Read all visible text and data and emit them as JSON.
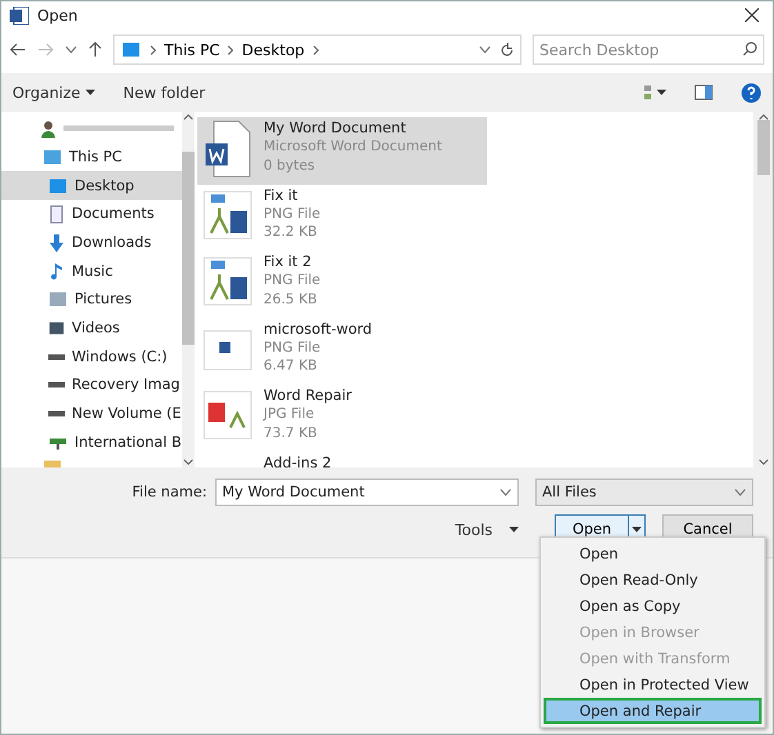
{
  "window": {
    "title": "Open"
  },
  "breadcrumb": [
    "This PC",
    "Desktop"
  ],
  "search": {
    "placeholder": "Search Desktop"
  },
  "toolbar": {
    "organize": "Organize",
    "new_folder": "New folder"
  },
  "sidebar": {
    "items": [
      {
        "label": "This PC",
        "kind": "pc",
        "selected": false,
        "children": [
          {
            "label": "Desktop",
            "kind": "desktop",
            "selected": true
          },
          {
            "label": "Documents",
            "kind": "doc",
            "selected": false
          },
          {
            "label": "Downloads",
            "kind": "download",
            "selected": false
          },
          {
            "label": "Music",
            "kind": "music",
            "selected": false
          },
          {
            "label": "Pictures",
            "kind": "pictures",
            "selected": false
          },
          {
            "label": "Videos",
            "kind": "videos",
            "selected": false
          },
          {
            "label": "Windows (C:)",
            "kind": "drive",
            "selected": false
          },
          {
            "label": "Recovery Imag",
            "kind": "drive",
            "selected": false
          },
          {
            "label": "New Volume (E",
            "kind": "drive",
            "selected": false
          },
          {
            "label": "International B",
            "kind": "network",
            "selected": false
          }
        ]
      }
    ]
  },
  "files": [
    {
      "name": "My Word Document",
      "type": "Microsoft Word Document",
      "size": "0 bytes",
      "kind": "word",
      "selected": true
    },
    {
      "name": "Fix it",
      "type": "PNG File",
      "size": "32.2 KB",
      "kind": "fixit",
      "selected": false
    },
    {
      "name": "Fix it 2",
      "type": "PNG File",
      "size": "26.5 KB",
      "kind": "fixit",
      "selected": false
    },
    {
      "name": "microsoft-word",
      "type": "PNG File",
      "size": "6.47 KB",
      "kind": "small",
      "selected": false
    },
    {
      "name": "Word Repair",
      "type": "JPG File",
      "size": "73.7 KB",
      "kind": "repair",
      "selected": false
    },
    {
      "name": "Add-ins 2",
      "kind": "partial",
      "selected": false
    }
  ],
  "file_name": {
    "label": "File name:",
    "value": "My Word Document"
  },
  "file_type": "All Files",
  "tools": "Tools",
  "open_button": "Open",
  "cancel_button": "Cancel",
  "open_menu": [
    {
      "label": "Open",
      "disabled": false,
      "selected": false
    },
    {
      "label": "Open Read-Only",
      "disabled": false,
      "selected": false
    },
    {
      "label": "Open as Copy",
      "disabled": false,
      "selected": false
    },
    {
      "label": "Open in Browser",
      "disabled": true,
      "selected": false
    },
    {
      "label": "Open with Transform",
      "disabled": true,
      "selected": false
    },
    {
      "label": "Open in Protected View",
      "disabled": false,
      "selected": false
    },
    {
      "label": "Open and Repair",
      "disabled": false,
      "selected": true
    }
  ]
}
